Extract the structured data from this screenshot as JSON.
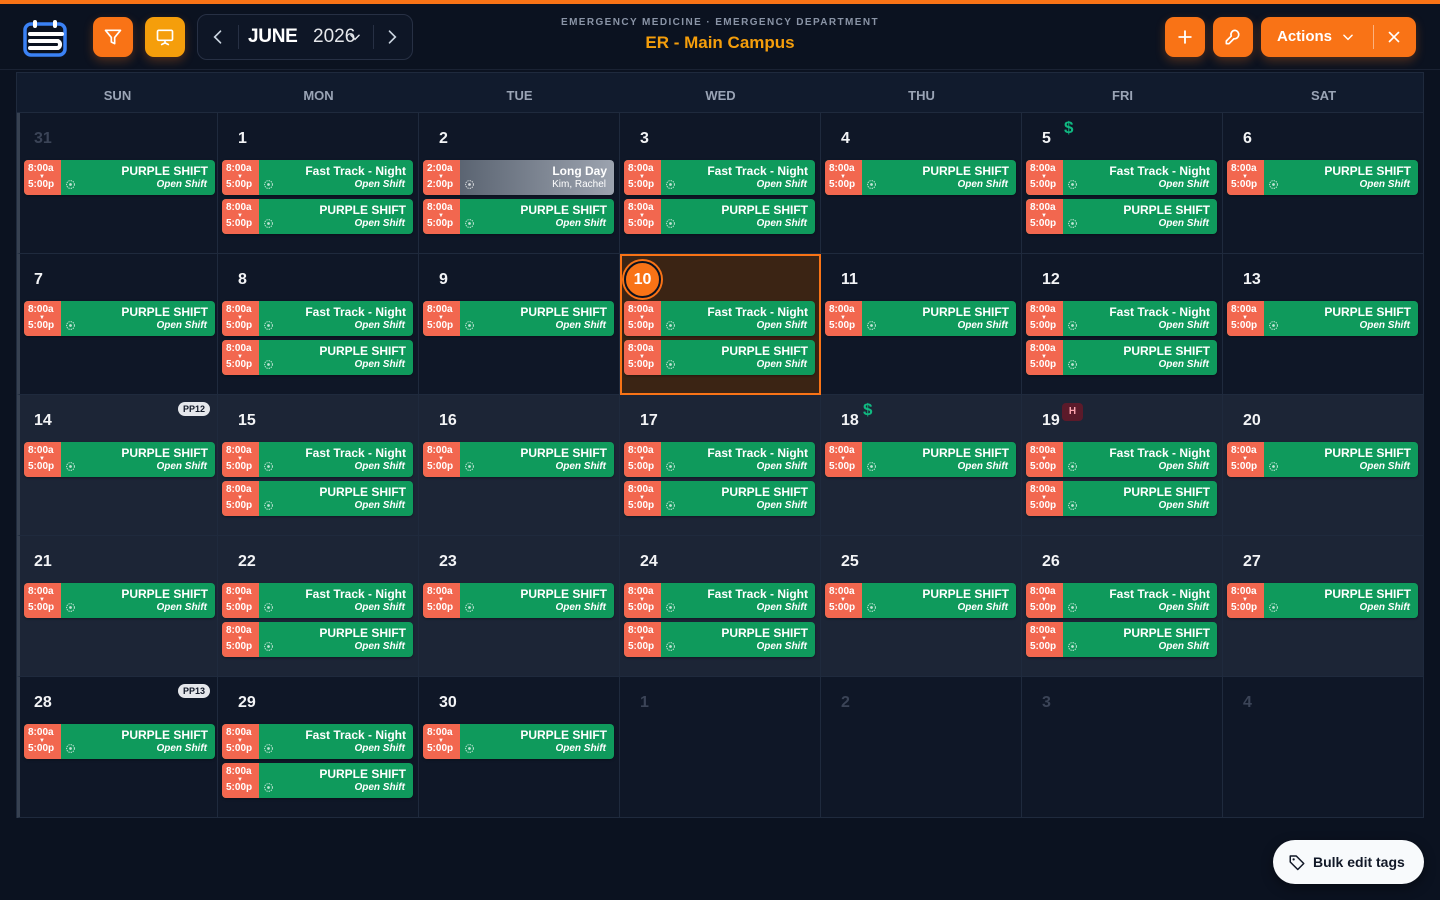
{
  "header": {
    "subtitle": "EMERGENCY MEDICINE · EMERGENCY DEPARTMENT",
    "title": "ER - Main Campus",
    "month": "JUNE",
    "year": "2026",
    "actions_label": "Actions"
  },
  "bulk_edit_label": "Bulk edit tags",
  "weekdays": [
    "SUN",
    "MON",
    "TUE",
    "WED",
    "THU",
    "FRI",
    "SAT"
  ],
  "shift_types": {
    "P": {
      "name": "PURPLE SHIFT",
      "sub": "Open Shift",
      "start": "8:00a",
      "end": "5:00p"
    },
    "F": {
      "name": "Fast Track - Night",
      "sub": "Open Shift",
      "start": "8:00a",
      "end": "5:00p"
    },
    "L": {
      "name": "Long Day",
      "sub": "Kim, Rachel",
      "start": "2:00a",
      "end": "2:00p"
    }
  },
  "weeks": [
    [
      {
        "day": "31",
        "other_month": true,
        "shifts": [
          "P"
        ]
      },
      {
        "day": "1",
        "shifts": [
          "F",
          "P"
        ]
      },
      {
        "day": "2",
        "shifts": [
          "L",
          "P"
        ]
      },
      {
        "day": "3",
        "shifts": [
          "F",
          "P"
        ]
      },
      {
        "day": "4",
        "shifts": [
          "P"
        ]
      },
      {
        "day": "5",
        "dollar": "$",
        "shifts": [
          "F",
          "P"
        ]
      },
      {
        "day": "6",
        "shifts": [
          "P"
        ]
      }
    ],
    [
      {
        "day": "7",
        "shifts": [
          "P"
        ]
      },
      {
        "day": "8",
        "shifts": [
          "F",
          "P"
        ]
      },
      {
        "day": "9",
        "shifts": [
          "P"
        ]
      },
      {
        "day": "10",
        "today": true,
        "shifts": [
          "F",
          "P"
        ]
      },
      {
        "day": "11",
        "shifts": [
          "P"
        ]
      },
      {
        "day": "12",
        "shifts": [
          "F",
          "P"
        ]
      },
      {
        "day": "13",
        "shifts": [
          "P"
        ]
      }
    ],
    [
      {
        "day": "14",
        "pp": "PP12",
        "shifts": [
          "P"
        ]
      },
      {
        "day": "15",
        "shifts": [
          "F",
          "P"
        ]
      },
      {
        "day": "16",
        "shifts": [
          "P"
        ]
      },
      {
        "day": "17",
        "shifts": [
          "F",
          "P"
        ]
      },
      {
        "day": "18",
        "dollar": "$",
        "shifts": [
          "P"
        ]
      },
      {
        "day": "19",
        "holiday": "H",
        "shifts": [
          "F",
          "P"
        ]
      },
      {
        "day": "20",
        "shifts": [
          "P"
        ]
      }
    ],
    [
      {
        "day": "21",
        "shifts": [
          "P"
        ]
      },
      {
        "day": "22",
        "shifts": [
          "F",
          "P"
        ]
      },
      {
        "day": "23",
        "shifts": [
          "P"
        ]
      },
      {
        "day": "24",
        "shifts": [
          "F",
          "P"
        ]
      },
      {
        "day": "25",
        "shifts": [
          "P"
        ]
      },
      {
        "day": "26",
        "shifts": [
          "F",
          "P"
        ]
      },
      {
        "day": "27",
        "shifts": [
          "P"
        ]
      }
    ],
    [
      {
        "day": "28",
        "pp": "PP13",
        "shifts": [
          "P"
        ]
      },
      {
        "day": "29",
        "shifts": [
          "F",
          "P"
        ]
      },
      {
        "day": "30",
        "shifts": [
          "P"
        ]
      },
      {
        "day": "1",
        "other_month": true,
        "shifts": []
      },
      {
        "day": "2",
        "other_month": true,
        "shifts": []
      },
      {
        "day": "3",
        "other_month": true,
        "shifts": []
      },
      {
        "day": "4",
        "other_month": true,
        "shifts": []
      }
    ]
  ],
  "colors": {
    "accent": "#f97316",
    "accent_yellow": "#f59e0b",
    "shift_green": "#0f9a5c",
    "time_salmon": "#f2674f",
    "money_green": "#10b981"
  }
}
